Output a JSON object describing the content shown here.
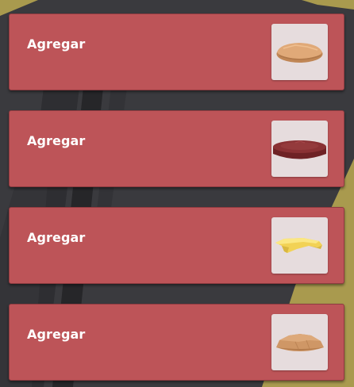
{
  "items": [
    {
      "label": "Agregar",
      "icon": "bun-top-icon"
    },
    {
      "label": "Agregar",
      "icon": "meat-patty-icon"
    },
    {
      "label": "Agregar",
      "icon": "cheese-slice-icon"
    },
    {
      "label": "Agregar",
      "icon": "bun-bottom-icon"
    }
  ],
  "colors": {
    "card": "#bd5458",
    "thumb_background": "#e6dcdd",
    "label": "#ffffff",
    "accent_yellow": "#a99a4e",
    "scene_background": "#3b3b3f"
  }
}
